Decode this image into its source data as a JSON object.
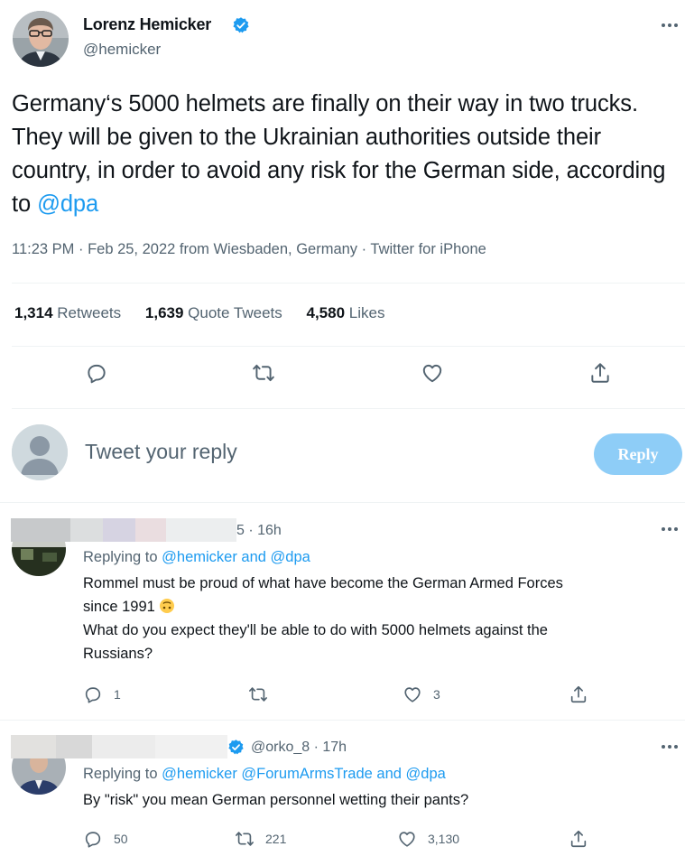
{
  "tweet": {
    "author_name": "Lorenz Hemicker",
    "author_handle": "@hemicker",
    "text": "Germany‘s 5000 helmets are finally on their way in two trucks. They will be given to the Ukrainian authorities outside their country, in order to avoid any risk for the German side, according to ",
    "mention": "@dpa",
    "meta": "11:23 PM · Feb 25, 2022 from Wiesbaden, Germany · Twitter for iPhone",
    "retweets_count": "1,314",
    "retweets_label": "Retweets",
    "quotes_count": "1,639",
    "quotes_label": "Quote Tweets",
    "likes_count": "4,580",
    "likes_label": "Likes"
  },
  "composer": {
    "placeholder": "Tweet your reply",
    "button_label": "Reply"
  },
  "replies": [
    {
      "meta": "5 · 16h",
      "replying_prefix": "Replying to",
      "replying_to": "@hemicker and @dpa",
      "text_line1": "Rommel must be proud of what have become the German Armed Forces",
      "text_line2": "since 1991",
      "text_line3": "What do you expect they'll be able to do with 5000 helmets against the",
      "text_line4": "Russians?",
      "reply_count": "1",
      "retweet_count": "",
      "like_count": "3"
    },
    {
      "meta": "@orko_8 · 17h",
      "replying_prefix": "Replying to",
      "replying_to": "@hemicker @ForumArmsTrade and @dpa",
      "text_line1": "By \"risk\" you mean German personnel wetting their pants?",
      "reply_count": "50",
      "retweet_count": "221",
      "like_count": "3,130"
    }
  ],
  "icons": {
    "verified": "verified-badge-icon",
    "more": "more-dots-icon",
    "reply": "reply-bubble-icon",
    "retweet": "retweet-arrows-icon",
    "like": "heart-icon",
    "share": "share-upload-icon",
    "emoji": "upside-down-face-icon"
  },
  "colors": {
    "accent": "#1d9bf0",
    "reply_button": "#8ecdf7",
    "secondary_text": "#536471",
    "divider": "#eff3f4"
  }
}
